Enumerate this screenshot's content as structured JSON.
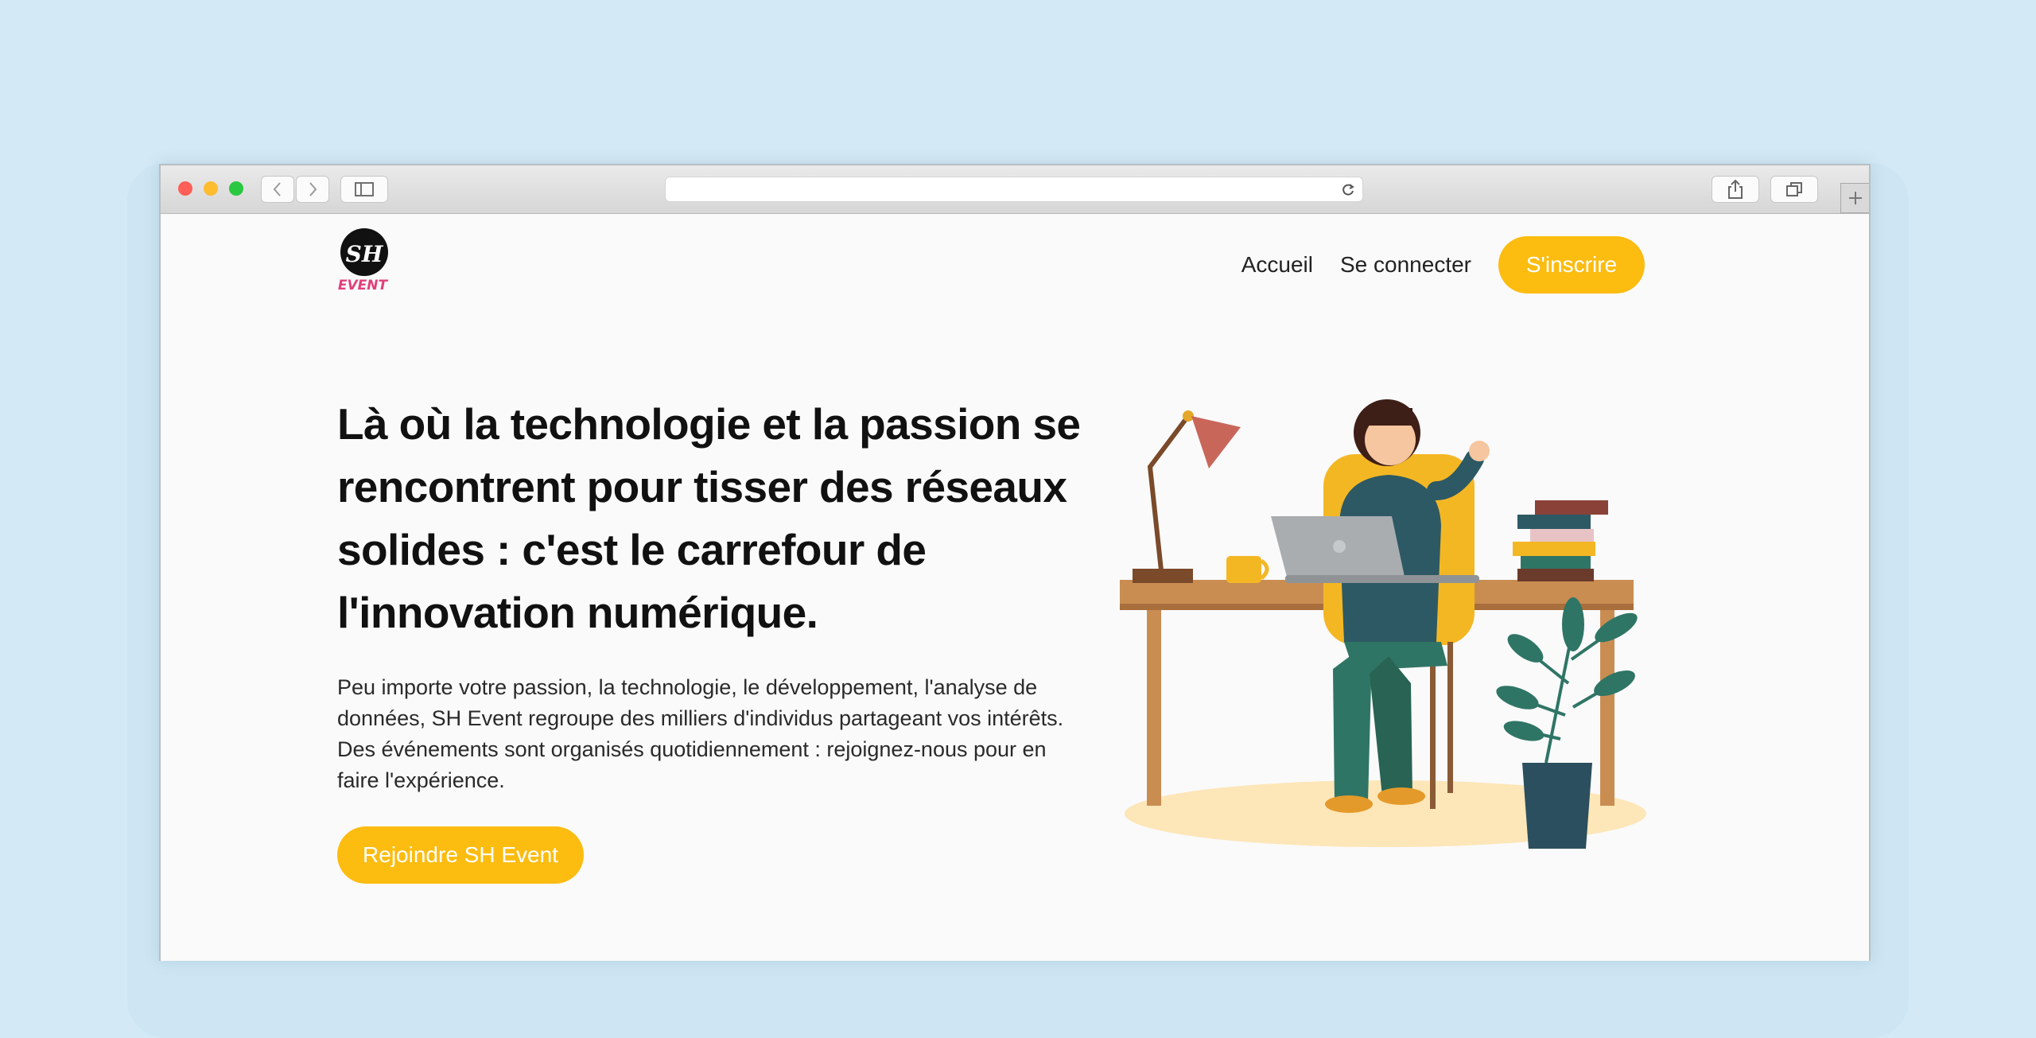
{
  "colors": {
    "accent": "#fcbc10",
    "background": "#d3e9f5",
    "page": "#fafafa",
    "logo_pink": "#e0407a"
  },
  "logo": {
    "mark": "SH",
    "word": "EVENT"
  },
  "nav": {
    "home": "Accueil",
    "login": "Se connecter",
    "signup": "S'inscrire"
  },
  "hero": {
    "title": "Là où la technologie et la passion se rencontrent pour tisser des réseaux solides : c'est le carrefour de l'innovation numérique.",
    "description": "Peu importe votre passion, la technologie, le développement, l'analyse de données, SH Event regroupe des milliers d'individus partageant vos intérêts. Des événements sont organisés quotidiennement : rejoignez-nous pour en faire l'expérience.",
    "cta": "Rejoindre SH Event"
  },
  "icons": {
    "back": "chevron-left-icon",
    "forward": "chevron-right-icon",
    "sidebar": "sidebar-icon",
    "reload": "reload-icon",
    "share": "share-icon",
    "tabs": "tabs-icon",
    "new_tab": "plus-icon"
  }
}
